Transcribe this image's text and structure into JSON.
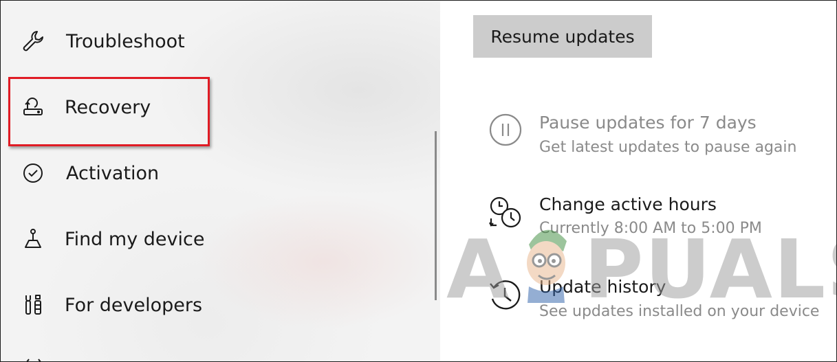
{
  "nav": {
    "items": [
      {
        "label": "Troubleshoot",
        "icon": "wrench-icon"
      },
      {
        "label": "Recovery",
        "icon": "recovery-icon"
      },
      {
        "label": "Activation",
        "icon": "check-circle-icon"
      },
      {
        "label": "Find my device",
        "icon": "find-device-icon"
      },
      {
        "label": "For developers",
        "icon": "developer-tools-icon"
      }
    ],
    "highlight_color": "#e01b24"
  },
  "updates": {
    "resume_label": "Resume updates",
    "options": [
      {
        "title": "Pause updates for 7 days",
        "subtitle": "Get latest updates to pause again",
        "icon": "pause-circle-icon",
        "enabled": false
      },
      {
        "title": "Change active hours",
        "subtitle": "Currently 8:00 AM to 5:00 PM",
        "icon": "active-hours-icon",
        "enabled": true
      },
      {
        "title": "Update history",
        "subtitle": "See updates installed on your device",
        "icon": "history-icon",
        "enabled": true
      }
    ]
  },
  "watermark": {
    "text_left": "A",
    "text_right": "PUALS"
  }
}
